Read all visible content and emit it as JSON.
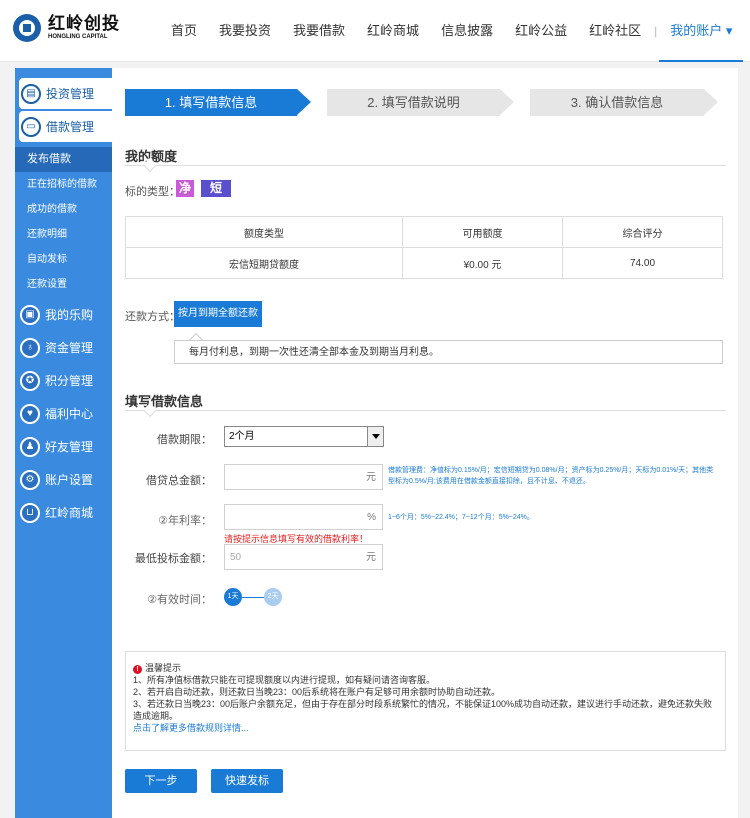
{
  "brand": {
    "name_cn": "红岭创投",
    "name_en": "HONGLING CAPITAL"
  },
  "nav": {
    "items": [
      "首页",
      "我要投资",
      "我要借款",
      "红岭商城",
      "信息披露",
      "红岭公益",
      "红岭社区"
    ],
    "account": "我的账户 ▾"
  },
  "sidebar": {
    "invest": "投资管理",
    "loan": "借款管理",
    "loan_sub": [
      "发布借款",
      "正在招标的借款",
      "成功的借款",
      "还款明细",
      "自动发标",
      "还款设置"
    ],
    "groups": [
      {
        "label": "我的乐购",
        "icon": "cart-icon",
        "glyph": "▣"
      },
      {
        "label": "资金管理",
        "icon": "money-bag-icon",
        "glyph": "♁"
      },
      {
        "label": "积分管理",
        "icon": "gift-icon",
        "glyph": "✪"
      },
      {
        "label": "福利中心",
        "icon": "heart-icon",
        "glyph": "♥"
      },
      {
        "label": "好友管理",
        "icon": "friends-icon",
        "glyph": "♟"
      },
      {
        "label": "账户设置",
        "icon": "gear-icon",
        "glyph": "⚙"
      },
      {
        "label": "红岭商城",
        "icon": "shop-cart-icon",
        "glyph": "⊔"
      }
    ]
  },
  "steps": [
    "1. 填写借款信息",
    "2. 填写借款说明",
    "3. 确认借款信息"
  ],
  "quota": {
    "title": "我的额度",
    "tag_label": "标的类型：",
    "tag1": "净",
    "tag2": "短",
    "tag1_color": "#c95bd6",
    "tag2_color": "#5a4fcf",
    "headers": [
      "额度类型",
      "可用额度",
      "综合评分"
    ],
    "row": [
      "宏信短期贷额度",
      "¥0.00 元",
      "74.00"
    ]
  },
  "repay": {
    "label": "还款方式：",
    "option": "按月到期全额还款",
    "desc": "每月付利息，到期一次性还清全部本金及到期当月利息。"
  },
  "form": {
    "title": "填写借款信息",
    "period_label": "借款期限：",
    "period_value": "2个月",
    "amount_label": "借贷总金额：",
    "amount_unit": "元",
    "amount_hint": "借款管理费：净值标为0.15%/月；宏信短期贷为0.08%/月；资产标为0.25%/月；天标为0.01%/天；其他类型标为0.5%/月;该费用在借款金额直接扣除，且不计息、不退还。",
    "rate_label": "②年利率：",
    "rate_unit": "%",
    "rate_hint": "1~6个月：5%~22.4%；7~12个月：5%~24%。",
    "rate_error": "请按提示信息填写有效的借款利率！",
    "min_label": "最低投标金额：",
    "min_placeholder": "50",
    "min_unit": "元",
    "valid_label": "②有效时间：",
    "valid_day1": "1天",
    "valid_day2": "2天"
  },
  "notice": {
    "title": "温馨提示",
    "lines": [
      "1、所有净值标借款只能在可提现额度以内进行提现，如有疑问请咨询客服。",
      "2、若开启自动还款，则还款日当晚23：00后系统将在账户有足够可用余额时协助自动还款。",
      "3、若还款日当晚23：00后账户余额充足，但由于存在部分时段系统繁忙的情况，不能保证100%成功自动还款，建议进行手动还款，避免还款失败造成逾期。"
    ],
    "link": "点击了解更多借款规则详情..."
  },
  "buttons": {
    "next": "下一步",
    "quick": "快速发标"
  }
}
